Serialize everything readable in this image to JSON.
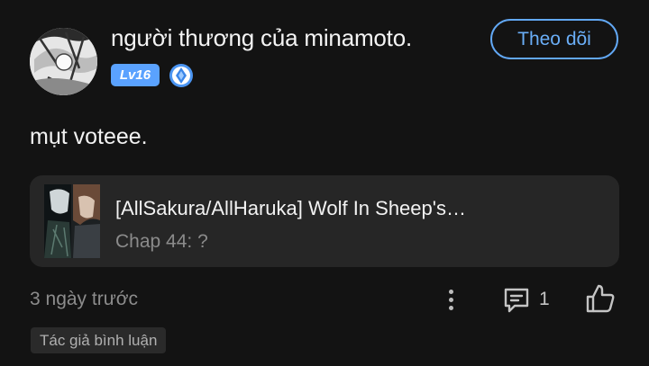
{
  "comment": {
    "user": {
      "name": "người thương của minamoto.",
      "level": "Lv16",
      "avatar_icon": "manga-avatar",
      "rank_icon": "blue-crystal-badge-icon"
    },
    "follow_label": "Theo dõi",
    "text": "mụt voteee.",
    "story": {
      "title": "[AllSakura/AllHaruka] Wolf In Sheep's Clothing",
      "chapter": "Chap 44: ?"
    },
    "time": "3 ngày trước",
    "reply_count": "1",
    "author_tag": "Tác giả bình luận"
  },
  "colors": {
    "background": "#131313",
    "accent": "#62a8f5",
    "level_badge": "#5aa2ff",
    "card": "#262626"
  }
}
